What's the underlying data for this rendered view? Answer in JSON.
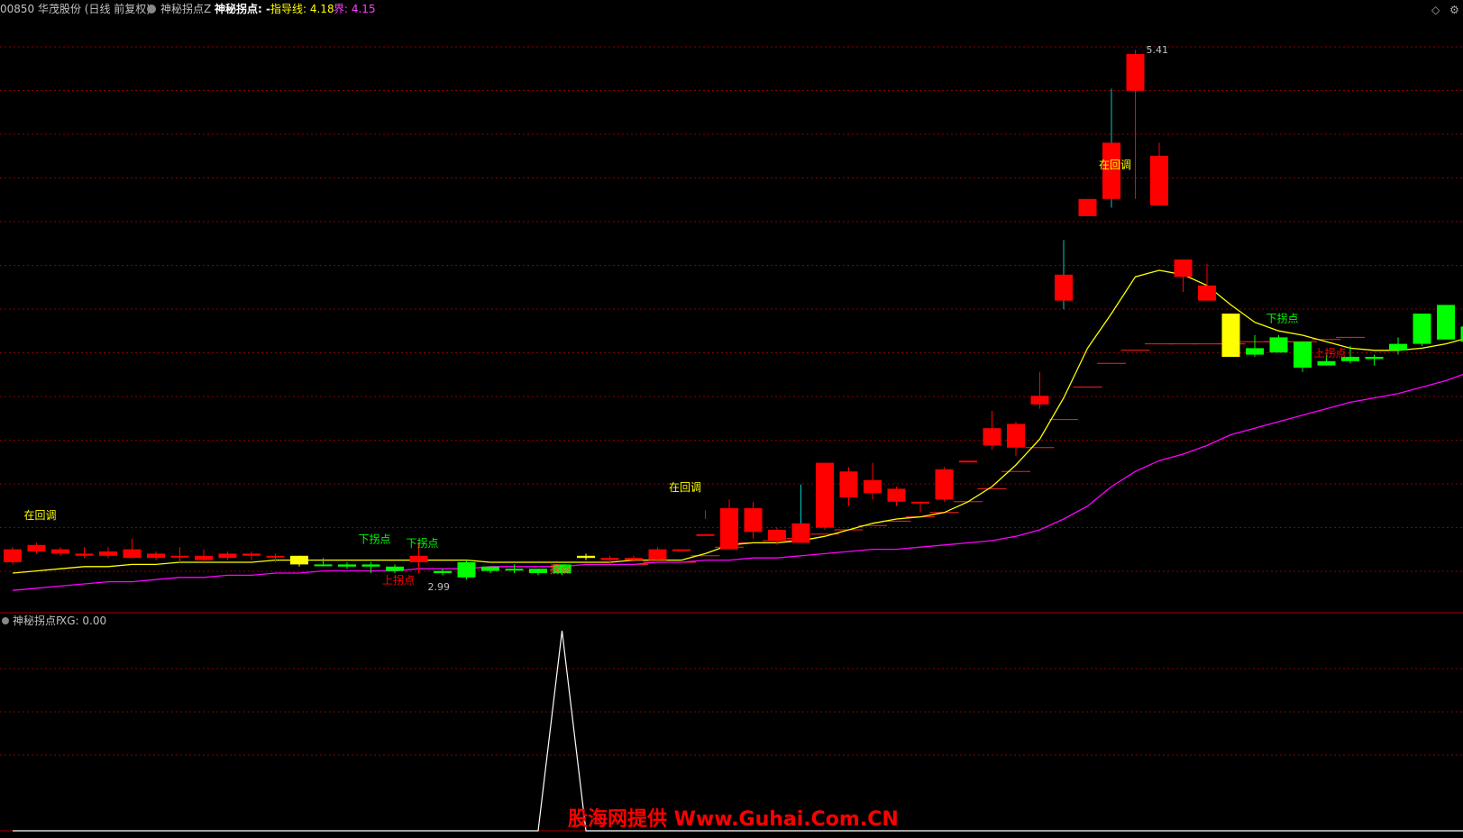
{
  "header": {
    "stock": "00850 华茂股份 (日线 前复权)",
    "indicator_name": "神秘拐点Z",
    "indicator_title": "神秘拐点: -",
    "guide_label": "指导线: 4.18",
    "bound_label": "界: 4.15",
    "icons": [
      "diamond-icon",
      "settings-icon"
    ]
  },
  "sub_header": {
    "indicator_name": "神秘拐点F",
    "xg_label": "XG: 0.00"
  },
  "colors": {
    "up": "#ff0000",
    "down": "#00ff00",
    "flat_yellow": "#ffff00",
    "guide_line": "#ffff00",
    "bound_line": "#ff00ff",
    "grid": "#8b0000",
    "panel_border": "#b00000",
    "wick_up_cyan": "#00c8c8"
  },
  "watermark": "股海网提供 Www.Guhai.Com.CN",
  "chart_data": {
    "type": "candlestick",
    "title": "",
    "price_high_label": "5.41",
    "price_low_label": "2.99",
    "candles": [
      {
        "o": 3.05,
        "c": 3.11,
        "h": 3.12,
        "l": 3.04,
        "color": "up"
      },
      {
        "o": 3.1,
        "c": 3.13,
        "h": 3.14,
        "l": 3.09,
        "color": "up"
      },
      {
        "o": 3.09,
        "c": 3.11,
        "h": 3.12,
        "l": 3.08,
        "color": "up"
      },
      {
        "o": 3.08,
        "c": 3.09,
        "h": 3.12,
        "l": 3.07,
        "color": "up"
      },
      {
        "o": 3.08,
        "c": 3.1,
        "h": 3.12,
        "l": 3.07,
        "color": "up"
      },
      {
        "o": 3.07,
        "c": 3.11,
        "h": 3.16,
        "l": 3.07,
        "color": "up"
      },
      {
        "o": 3.07,
        "c": 3.09,
        "h": 3.1,
        "l": 3.06,
        "color": "up"
      },
      {
        "o": 3.08,
        "c": 3.08,
        "h": 3.12,
        "l": 3.05,
        "color": "up"
      },
      {
        "o": 3.06,
        "c": 3.08,
        "h": 3.11,
        "l": 3.05,
        "color": "up"
      },
      {
        "o": 3.07,
        "c": 3.09,
        "h": 3.1,
        "l": 3.06,
        "color": "up"
      },
      {
        "o": 3.08,
        "c": 3.09,
        "h": 3.1,
        "l": 3.06,
        "color": "up"
      },
      {
        "o": 3.08,
        "c": 3.08,
        "h": 3.09,
        "l": 3.05,
        "color": "up"
      },
      {
        "o": 3.08,
        "c": 3.04,
        "h": 3.08,
        "l": 3.03,
        "color": "flat_yellow"
      },
      {
        "o": 3.04,
        "c": 3.04,
        "h": 3.07,
        "l": 3.03,
        "color": "down"
      },
      {
        "o": 3.04,
        "c": 3.03,
        "h": 3.05,
        "l": 3.02,
        "color": "down"
      },
      {
        "o": 3.03,
        "c": 3.04,
        "h": 3.05,
        "l": 3.0,
        "color": "down"
      },
      {
        "o": 3.03,
        "c": 3.01,
        "h": 3.04,
        "l": 3.0,
        "color": "down"
      },
      {
        "o": 3.05,
        "c": 3.08,
        "h": 3.14,
        "l": 3.0,
        "color": "up"
      },
      {
        "o": 3.01,
        "c": 3.0,
        "h": 3.02,
        "l": 2.99,
        "color": "down"
      },
      {
        "o": 3.05,
        "c": 2.98,
        "h": 3.06,
        "l": 2.97,
        "color": "down"
      },
      {
        "o": 3.03,
        "c": 3.01,
        "h": 3.03,
        "l": 3.0,
        "color": "down"
      },
      {
        "o": 3.02,
        "c": 3.02,
        "h": 3.04,
        "l": 3.0,
        "color": "down"
      },
      {
        "o": 3.02,
        "c": 3.0,
        "h": 3.02,
        "l": 2.99,
        "color": "down"
      },
      {
        "o": 3.04,
        "c": 3.0,
        "h": 3.04,
        "l": 2.99,
        "color": "down"
      },
      {
        "o": 3.07,
        "c": 3.08,
        "h": 3.09,
        "l": 3.06,
        "color": "flat_yellow"
      },
      {
        "o": 3.06,
        "c": 3.07,
        "h": 3.08,
        "l": 3.04,
        "color": "up"
      },
      {
        "o": 3.06,
        "c": 3.07,
        "h": 3.08,
        "l": 3.05,
        "color": "up"
      },
      {
        "o": 3.06,
        "c": 3.11,
        "h": 3.12,
        "l": 3.05,
        "color": "up"
      },
      {
        "o": 3.11,
        "c": 3.11,
        "h": 3.11,
        "l": 3.11,
        "color": "up"
      },
      {
        "o": 3.18,
        "c": 3.18,
        "h": 3.29,
        "l": 3.25,
        "color": "up"
      },
      {
        "o": 3.11,
        "c": 3.3,
        "h": 3.34,
        "l": 3.11,
        "color": "up"
      },
      {
        "o": 3.19,
        "c": 3.3,
        "h": 3.33,
        "l": 3.16,
        "color": "up"
      },
      {
        "o": 3.15,
        "c": 3.2,
        "h": 3.21,
        "l": 3.13,
        "color": "up"
      },
      {
        "o": 3.14,
        "c": 3.23,
        "h": 3.41,
        "l": 3.14,
        "color": "up"
      },
      {
        "o": 3.21,
        "c": 3.51,
        "h": 3.51,
        "l": 3.2,
        "color": "up"
      },
      {
        "o": 3.35,
        "c": 3.47,
        "h": 3.49,
        "l": 3.31,
        "color": "up"
      },
      {
        "o": 3.37,
        "c": 3.43,
        "h": 3.51,
        "l": 3.34,
        "color": "up"
      },
      {
        "o": 3.33,
        "c": 3.39,
        "h": 3.4,
        "l": 3.31,
        "color": "up"
      },
      {
        "o": 3.33,
        "c": 3.33,
        "h": 3.33,
        "l": 3.28,
        "color": "up"
      },
      {
        "o": 3.34,
        "c": 3.48,
        "h": 3.49,
        "l": 3.33,
        "color": "up"
      },
      {
        "o": 3.52,
        "c": 3.52,
        "h": 3.52,
        "l": 3.52,
        "color": "up"
      },
      {
        "o": 3.59,
        "c": 3.67,
        "h": 3.75,
        "l": 3.57,
        "color": "up"
      },
      {
        "o": 3.58,
        "c": 3.69,
        "h": 3.7,
        "l": 3.54,
        "color": "up"
      },
      {
        "o": 3.78,
        "c": 3.82,
        "h": 3.93,
        "l": 3.76,
        "color": "up"
      },
      {
        "o": 4.26,
        "c": 4.38,
        "h": 4.54,
        "l": 4.22,
        "color": "up"
      },
      {
        "o": 4.65,
        "c": 4.73,
        "h": 4.73,
        "l": 4.65,
        "color": "up"
      },
      {
        "o": 4.73,
        "c": 4.99,
        "h": 5.24,
        "l": 4.69,
        "color": "up"
      },
      {
        "o": 5.23,
        "c": 5.4,
        "h": 5.42,
        "l": 4.73,
        "color": "up"
      },
      {
        "o": 4.7,
        "c": 4.93,
        "h": 4.99,
        "l": 4.7,
        "color": "up"
      },
      {
        "o": 4.37,
        "c": 4.45,
        "h": 4.45,
        "l": 4.3,
        "color": "up"
      },
      {
        "o": 4.26,
        "c": 4.33,
        "h": 4.43,
        "l": 4.26,
        "color": "up"
      },
      {
        "o": 4.0,
        "c": 4.2,
        "h": 4.2,
        "l": 4.0,
        "color": "flat_yellow"
      },
      {
        "o": 4.01,
        "c": 4.04,
        "h": 4.1,
        "l": 4.0,
        "color": "down"
      },
      {
        "o": 4.02,
        "c": 4.09,
        "h": 4.1,
        "l": 4.02,
        "color": "down"
      },
      {
        "o": 3.95,
        "c": 4.07,
        "h": 4.07,
        "l": 3.93,
        "color": "down"
      },
      {
        "o": 3.96,
        "c": 3.98,
        "h": 4.01,
        "l": 3.96,
        "color": "down"
      },
      {
        "o": 3.98,
        "c": 4.0,
        "h": 4.05,
        "l": 3.97,
        "color": "down"
      },
      {
        "o": 3.99,
        "c": 4.0,
        "h": 4.01,
        "l": 3.96,
        "color": "down"
      },
      {
        "o": 4.03,
        "c": 4.06,
        "h": 4.09,
        "l": 4.01,
        "color": "down"
      },
      {
        "o": 4.06,
        "c": 4.2,
        "h": 4.2,
        "l": 4.05,
        "color": "down"
      },
      {
        "o": 4.08,
        "c": 4.24,
        "h": 4.24,
        "l": 4.08,
        "color": "down"
      },
      {
        "o": 4.07,
        "c": 4.14,
        "h": 4.15,
        "l": 4.05,
        "color": "down"
      },
      {
        "o": 4.15,
        "c": 4.29,
        "h": 4.3,
        "l": 4.12,
        "color": "down"
      },
      {
        "o": 4.13,
        "c": 4.29,
        "h": 4.31,
        "l": 4.13,
        "color": "down"
      }
    ],
    "guide_line": [
      3.0,
      3.01,
      3.02,
      3.03,
      3.03,
      3.04,
      3.04,
      3.05,
      3.05,
      3.05,
      3.05,
      3.06,
      3.06,
      3.06,
      3.06,
      3.06,
      3.06,
      3.06,
      3.06,
      3.06,
      3.05,
      3.05,
      3.05,
      3.05,
      3.05,
      3.05,
      3.06,
      3.06,
      3.06,
      3.09,
      3.13,
      3.14,
      3.14,
      3.15,
      3.17,
      3.2,
      3.23,
      3.25,
      3.26,
      3.28,
      3.33,
      3.4,
      3.5,
      3.62,
      3.81,
      4.04,
      4.2,
      4.37,
      4.4,
      4.38,
      4.33,
      4.24,
      4.16,
      4.12,
      4.1,
      4.07,
      4.04,
      4.03,
      4.03,
      4.04,
      4.06,
      4.09,
      4.1,
      4.13,
      4.15
    ],
    "bound_line": [
      2.92,
      2.93,
      2.94,
      2.95,
      2.96,
      2.96,
      2.97,
      2.98,
      2.98,
      2.99,
      2.99,
      3.0,
      3.0,
      3.01,
      3.01,
      3.01,
      3.01,
      3.02,
      3.02,
      3.02,
      3.03,
      3.03,
      3.03,
      3.03,
      3.04,
      3.04,
      3.04,
      3.05,
      3.05,
      3.06,
      3.06,
      3.07,
      3.07,
      3.08,
      3.09,
      3.1,
      3.11,
      3.11,
      3.12,
      3.13,
      3.14,
      3.15,
      3.17,
      3.2,
      3.25,
      3.31,
      3.4,
      3.47,
      3.52,
      3.55,
      3.59,
      3.64,
      3.67,
      3.7,
      3.73,
      3.76,
      3.79,
      3.81,
      3.83,
      3.86,
      3.89,
      3.93,
      3.96,
      3.99,
      4.02
    ],
    "support_lines": [
      {
        "i": 26,
        "v": 3.04
      },
      {
        "i": 27,
        "v": 3.05
      },
      {
        "i": 28,
        "v": 3.05
      },
      {
        "i": 29,
        "v": 3.08
      },
      {
        "i": 30,
        "v": 3.12
      },
      {
        "i": 31,
        "v": 3.14
      },
      {
        "i": 32,
        "v": 3.15
      },
      {
        "i": 33,
        "v": 3.16
      },
      {
        "i": 34,
        "v": 3.18
      },
      {
        "i": 35,
        "v": 3.2
      },
      {
        "i": 36,
        "v": 3.22
      },
      {
        "i": 37,
        "v": 3.24
      },
      {
        "i": 38,
        "v": 3.26
      },
      {
        "i": 39,
        "v": 3.28
      },
      {
        "i": 40,
        "v": 3.33
      },
      {
        "i": 41,
        "v": 3.39
      },
      {
        "i": 42,
        "v": 3.47
      },
      {
        "i": 43,
        "v": 3.58
      },
      {
        "i": 44,
        "v": 3.71
      },
      {
        "i": 45,
        "v": 3.86
      },
      {
        "i": 46,
        "v": 3.97
      },
      {
        "i": 47,
        "v": 4.03
      },
      {
        "i": 48,
        "v": 4.06
      },
      {
        "i": 49,
        "v": 4.06
      },
      {
        "i": 50,
        "v": 4.06
      },
      {
        "i": 51,
        "v": 4.06
      },
      {
        "i": 52,
        "v": 4.07
      },
      {
        "i": 53,
        "v": 4.07
      },
      {
        "i": 54,
        "v": 4.07
      },
      {
        "i": 55,
        "v": 4.08
      },
      {
        "i": 56,
        "v": 4.09
      }
    ],
    "annotations": [
      {
        "text": "在回调",
        "i": 1,
        "v": 3.25,
        "color": "#ffff00"
      },
      {
        "text": "下拐点",
        "i": 15,
        "v": 3.14,
        "color": "#00ff00"
      },
      {
        "text": "下拐点",
        "i": 17,
        "v": 3.12,
        "color": "#00ff00"
      },
      {
        "text": "上拐点",
        "i": 16,
        "v": 2.95,
        "color": "#ff0000"
      },
      {
        "text": "拐点",
        "i": 23,
        "v": 3.0,
        "color": "#ff4040"
      },
      {
        "text": "在回调",
        "i": 28,
        "v": 3.38,
        "color": "#ffff00"
      },
      {
        "text": "在回调",
        "i": 46,
        "v": 4.87,
        "color": "#ffff00"
      },
      {
        "text": "下拐点",
        "i": 53,
        "v": 4.16,
        "color": "#00ff00"
      },
      {
        "text": "上拐点",
        "i": 55,
        "v": 4.0,
        "color": "#ff0000"
      }
    ],
    "sub_chart": {
      "type": "line",
      "values": [
        0,
        0,
        0,
        0,
        0,
        0,
        0,
        0,
        0,
        0,
        0,
        0,
        0,
        0,
        0,
        0,
        0,
        0,
        0,
        0,
        0,
        0,
        0,
        1,
        0,
        0,
        0,
        0,
        0,
        0,
        0,
        0,
        0,
        0,
        0,
        0,
        0,
        0,
        0,
        0,
        0,
        0,
        0,
        0,
        0,
        0,
        0,
        0,
        0,
        0,
        0,
        0,
        0,
        0,
        0,
        0,
        0,
        0,
        0,
        0,
        0,
        0,
        0,
        0,
        0
      ],
      "ylim": [
        0,
        1
      ]
    }
  }
}
